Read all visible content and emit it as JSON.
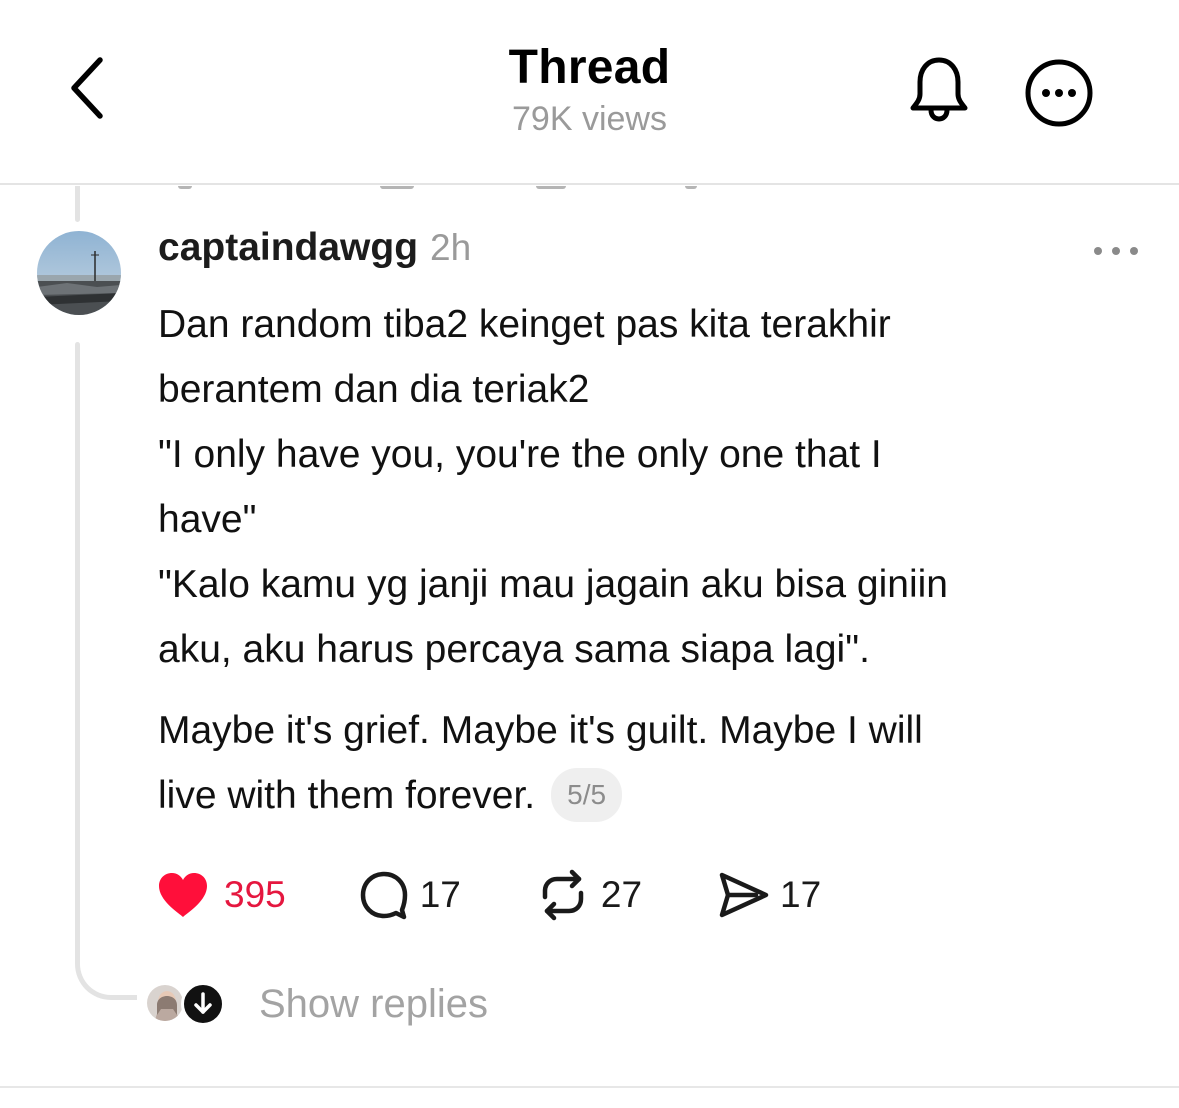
{
  "header": {
    "title": "Thread",
    "views": "79K views",
    "icons": {
      "back": "chevron-left-icon",
      "notify": "bell-icon",
      "more": "more-circle-icon"
    }
  },
  "post": {
    "username": "captaindawgg",
    "timestamp": "2h",
    "lines": [
      "Dan random tiba2 keinget pas kita terakhir",
      "berantem dan dia teriak2",
      "\"I only have you, you're the only one that I",
      "have\"",
      "\"Kalo kamu yg janji mau jagain aku bisa giniin",
      "aku, aku harus percaya sama siapa lagi\".",
      "Maybe it's grief. Maybe it's guilt. Maybe I will",
      "live with them forever."
    ],
    "thread_position": "5/5",
    "actions": {
      "likes": "395",
      "replies": "17",
      "reposts": "27",
      "shares": "17"
    }
  },
  "replies": {
    "label": "Show replies"
  },
  "colors": {
    "like_red": "#e5173f",
    "muted_text": "#9a9a9a",
    "thread_line": "#e3e3e3"
  }
}
